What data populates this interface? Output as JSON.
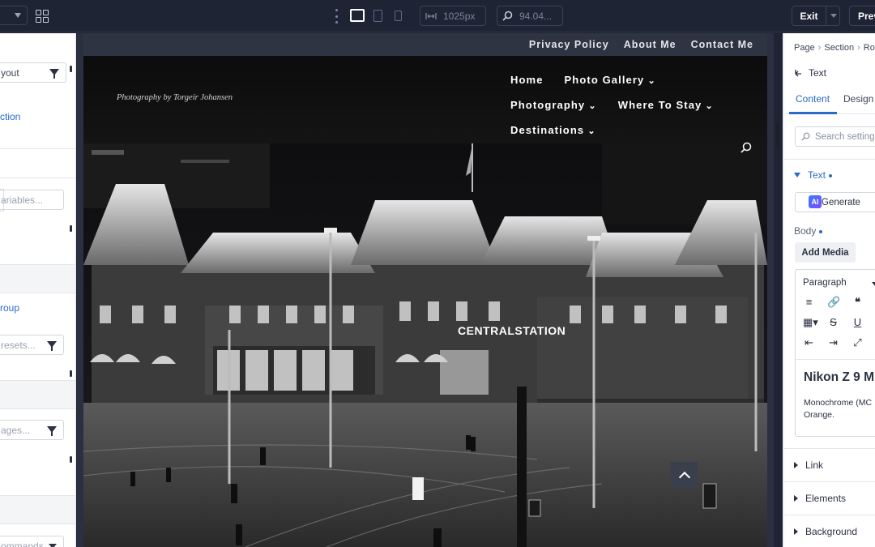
{
  "toolbar": {
    "width_value": "1025px",
    "zoom_value": "94.04...",
    "exit_label": "Exit",
    "preview_label": "Previ"
  },
  "left_panel": {
    "layout_select": "yout",
    "section_link": "ction",
    "variables_placeholder": "ariables...",
    "group_link": "roup",
    "presets_placeholder": "resets...",
    "pages_placeholder": "ages...",
    "commands_placeholder": "ommands"
  },
  "site": {
    "top_links": [
      "Privacy Policy",
      "About Me",
      "Contact Me"
    ],
    "tagline": "Photography by Torgeir Johansen",
    "nav_row1": [
      {
        "label": "Home",
        "dropdown": false
      },
      {
        "label": "Photo Gallery",
        "dropdown": true
      }
    ],
    "nav_row2": [
      {
        "label": "Photography",
        "dropdown": true
      },
      {
        "label": "Where To Stay",
        "dropdown": true
      }
    ],
    "nav_row3": [
      {
        "label": "Destinations",
        "dropdown": true
      }
    ],
    "station_sign": "CENTRALSTATION"
  },
  "right_panel": {
    "breadcrumb": [
      "Page",
      "Section",
      "Ro"
    ],
    "element_title": "Text",
    "tabs": [
      "Content",
      "Design"
    ],
    "search_placeholder": "Search setting",
    "section_text": "Text",
    "generate_label": "Generate",
    "ai_badge": "AI",
    "body_label": "Body",
    "add_media_label": "Add Media",
    "paragraph_select": "Paragraph",
    "editor_heading": "Nikon Z 9 M",
    "editor_body_line1": "Monochrome (MC",
    "editor_body_line2": "Orange.",
    "collapsed_sections": [
      "Link",
      "Elements",
      "Background"
    ]
  },
  "colors": {
    "accent": "#2a6ac8",
    "topbar_bg": "#1e2433",
    "site_bg": "#2f3442"
  }
}
